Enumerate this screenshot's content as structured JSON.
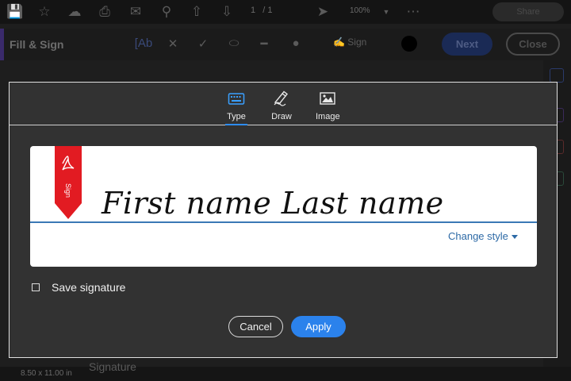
{
  "toolbar": {
    "page_current": "1",
    "page_total": "/ 1",
    "zoom": "100%",
    "share_label": "Share"
  },
  "fill_sign": {
    "title": "Fill & Sign",
    "sign_label": "Sign",
    "next_label": "Next",
    "close_label": "Close"
  },
  "dialog": {
    "tabs": [
      {
        "label": "Type",
        "icon": "keyboard-icon",
        "selected": true
      },
      {
        "label": "Draw",
        "icon": "pen-icon",
        "selected": false
      },
      {
        "label": "Image",
        "icon": "image-icon",
        "selected": false
      }
    ],
    "bookmark_label": "Sign",
    "signature_text": "First name Last name",
    "change_style_label": "Change style",
    "save_signature_label": "Save signature",
    "save_signature_checked": false,
    "cancel_label": "Cancel",
    "apply_label": "Apply",
    "accent_color": "#2b82ec"
  },
  "status": {
    "page_size": "8.50 x 11.00 in",
    "signature_heading": "Signature"
  }
}
